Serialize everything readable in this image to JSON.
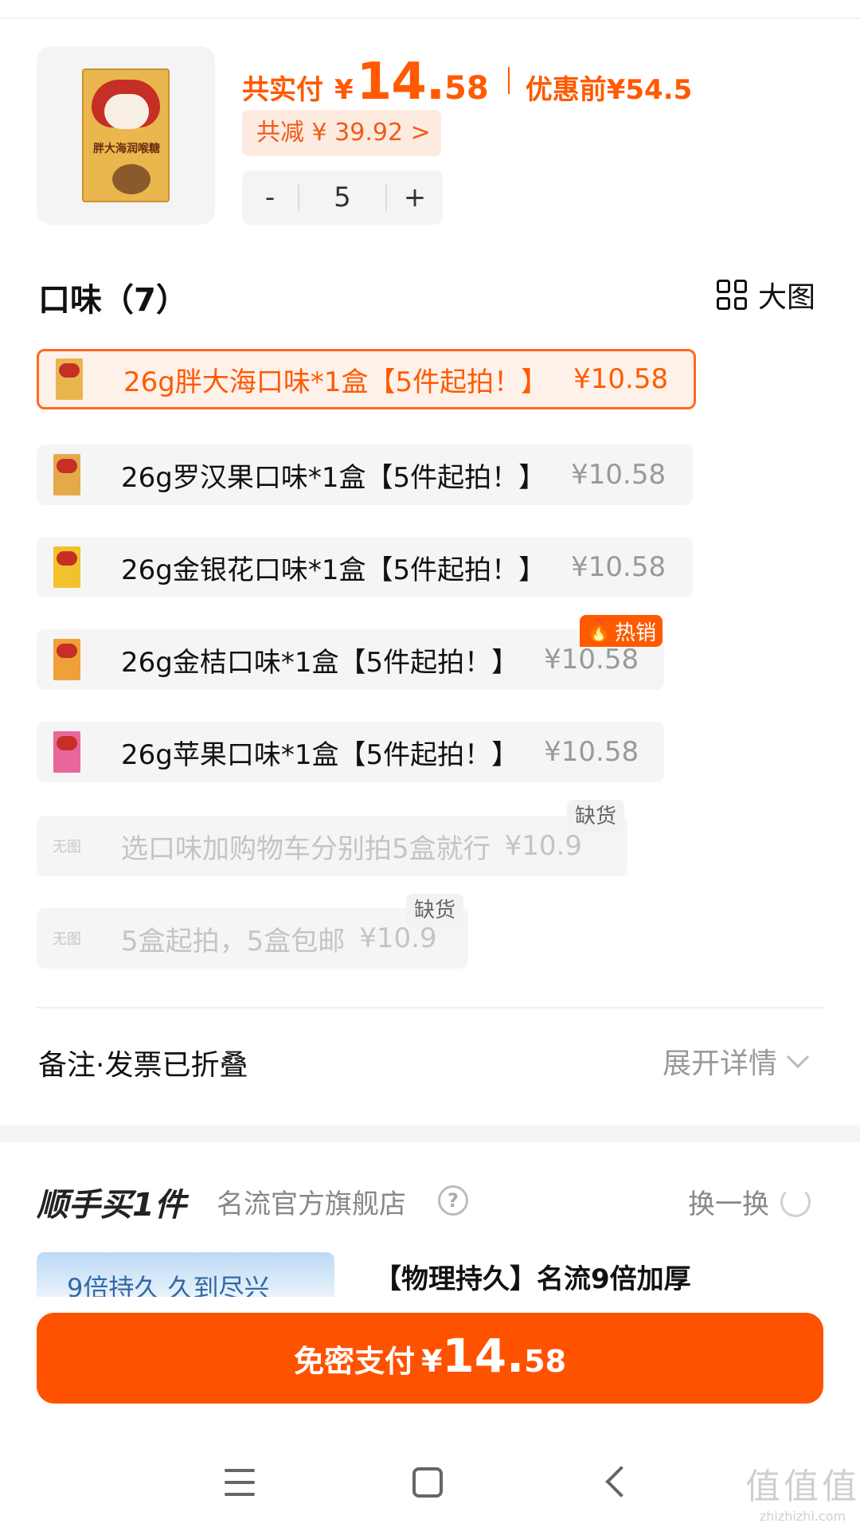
{
  "product": {
    "thumb_label": "胖大海润喉糖",
    "pay_label": "共实付",
    "pay_currency": "¥",
    "pay_integer": "14.",
    "pay_decimal": "58",
    "original_label": "优惠前¥54.5",
    "discount_label": "共减 ¥ 39.92 >",
    "quantity": "5",
    "minus": "-",
    "plus": "+"
  },
  "flavors": {
    "title": "口味（7）",
    "view_label": "大图",
    "options": [
      {
        "label": "26g胖大海口味*1盒【5件起拍！】",
        "price": "¥10.58",
        "color": "#e7b64f"
      },
      {
        "label": "26g罗汉果口味*1盒【5件起拍！】",
        "price": "¥10.58",
        "color": "#e5a94a"
      },
      {
        "label": "26g金银花口味*1盒【5件起拍！】",
        "price": "¥10.58",
        "color": "#f2c22e"
      },
      {
        "label": "26g金桔口味*1盒【5件起拍！】",
        "price": "¥10.58",
        "color": "#f0a03a"
      },
      {
        "label": "26g苹果口味*1盒【5件起拍！】",
        "price": "¥10.58",
        "color": "#e8679a"
      },
      {
        "label": "选口味加购物车分别拍5盒就行",
        "price": "¥10.9",
        "noimg": "无图"
      },
      {
        "label": "5盒起拍，5盒包邮",
        "price": "¥10.9",
        "noimg": "无图"
      }
    ],
    "hot_badge": "热销",
    "out_of_stock_badge": "缺货"
  },
  "notes": {
    "label": "备注·发票已折叠",
    "expand_label": "展开详情"
  },
  "recommend": {
    "title": "顺手买1件",
    "store": "名流官方旗舰店",
    "swap_label": "换一换",
    "image_text": "9倍持久 久到尽兴",
    "product_title": "【物理持久】名流9倍加厚"
  },
  "pay_button": {
    "label": "免密支付",
    "currency": "¥",
    "integer": "14.",
    "decimal": "58"
  },
  "watermark": {
    "glyphs": "值值值",
    "site": "zhizhizhi.com"
  },
  "colors": {
    "accent": "#ff5a00",
    "selected_bg": "#fef1ea"
  }
}
